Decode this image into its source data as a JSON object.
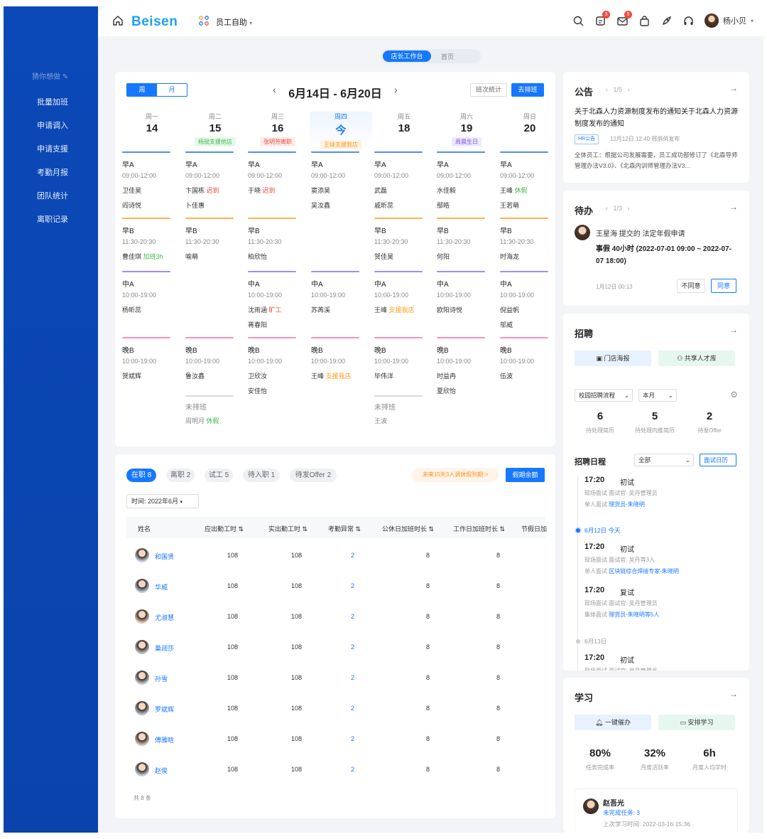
{
  "header": {
    "logo": "Beisen",
    "nav_label": "员工自助",
    "user_name": "杨小贝",
    "badges": [
      "3",
      "5"
    ]
  },
  "sidebar": {
    "guess": "猜你想做",
    "items": [
      "批量加班",
      "申请调入",
      "申请支援",
      "考勤月报",
      "团队统计",
      "离职记录"
    ]
  },
  "top_tabs": [
    "店长工作台",
    "首页"
  ],
  "schedule": {
    "view_week": "周",
    "view_month": "月",
    "date_range": "6月14日 - 6月20日",
    "btn_stats": "班次统计",
    "btn_go": "去排班",
    "days": [
      {
        "weekday": "周一",
        "num": "14",
        "tag": ""
      },
      {
        "weekday": "周二",
        "num": "15",
        "tag": "杨锐支援他店",
        "tag_color": "#3fb950",
        "tag_bg": "#e7f7ec"
      },
      {
        "weekday": "周三",
        "num": "16",
        "tag": "张明芳离职",
        "tag_color": "#f04b3b",
        "tag_bg": "#fdeceb"
      },
      {
        "weekday": "周四",
        "num": "今",
        "tag": "王峰支援我店",
        "tag_color": "#ff9c1a",
        "tag_bg": "#fff3e3"
      },
      {
        "weekday": "周五",
        "num": "18",
        "tag": ""
      },
      {
        "weekday": "周六",
        "num": "19",
        "tag": "周晨生日",
        "tag_color": "#7e57e8",
        "tag_bg": "#efe9ff"
      },
      {
        "weekday": "周日",
        "num": "20",
        "tag": ""
      }
    ],
    "shift_colors": {
      "早A": "#4d8dff",
      "早B": "#ffb24d",
      "中A": "#9e8cff",
      "晚B": "#ff8fc2"
    },
    "columns": [
      {
        "shifts": [
          {
            "name": "早A",
            "time": "09:00-12:00",
            "people": [
              [
                "卫佳昊",
                ""
              ],
              [
                "阎诗悦",
                ""
              ]
            ]
          },
          {
            "name": "早B",
            "time": "11:30-20:30",
            "people": [
              [
                "曹佳琪",
                "加班3h",
                "green"
              ]
            ]
          },
          {
            "name": "中A",
            "time": "10:00-19:00",
            "people": [
              [
                "杨昕蕊",
                ""
              ]
            ]
          },
          {
            "name": "晚B",
            "time": "10:00-19:00",
            "people": [
              [
                "贺斌辉",
                ""
              ]
            ]
          }
        ]
      },
      {
        "shifts": [
          {
            "name": "早A",
            "time": "09:00-12:00",
            "people": [
              [
                "卞国栋",
                "迟到",
                "red"
              ],
              [
                "卜佳惠",
                ""
              ]
            ]
          },
          {
            "name": "早B",
            "time": "11:30-20:30",
            "people": [
              [
                "喻萌",
                ""
              ]
            ]
          },
          {
            "name": "晚B",
            "time": "10:00-19:00",
            "people": [
              [
                "鲁汝鑫",
                ""
              ]
            ]
          },
          {
            "name": "未排班",
            "time": "",
            "people": [
              [
                "周明月",
                "休假",
                "green"
              ]
            ],
            "unscheduled": true
          }
        ]
      },
      {
        "shifts": [
          {
            "name": "早A",
            "time": "09:00-12:00",
            "people": [
              [
                "于晓",
                "迟到",
                "red"
              ]
            ]
          },
          {
            "name": "早B",
            "time": "11:30-20:30",
            "people": [
              [
                "柏欣怡",
                ""
              ]
            ]
          },
          {
            "name": "中A",
            "time": "10:00-19:00",
            "people": [
              [
                "沈雨涵",
                "旷工",
                "red"
              ],
              [
                "蒋春阳",
                ""
              ]
            ]
          },
          {
            "name": "晚B",
            "time": "10:00-19:00",
            "people": [
              [
                "卫欣汝",
                ""
              ],
              [
                "安佳怡",
                ""
              ]
            ]
          }
        ]
      },
      {
        "shifts": [
          {
            "name": "早A",
            "time": "09:00-12:00",
            "people": [
              [
                "窦添昊",
                ""
              ],
              [
                "吴汝鑫",
                ""
              ]
            ]
          },
          {
            "name": "中A",
            "time": "10:00-19:00",
            "people": [
              [
                "苏苒溪",
                ""
              ]
            ]
          },
          {
            "name": "晚B",
            "time": "10:00-19:00",
            "people": [
              [
                "王峰",
                "支援我店",
                "orange"
              ]
            ]
          }
        ]
      },
      {
        "shifts": [
          {
            "name": "早A",
            "time": "09:00-12:00",
            "people": [
              [
                "武磊",
                ""
              ],
              [
                "戚昕蕊",
                ""
              ]
            ]
          },
          {
            "name": "早B",
            "time": "11:30-20:30",
            "people": [
              [
                "贺佳昊",
                ""
              ]
            ]
          },
          {
            "name": "中A",
            "time": "10:00-19:00",
            "people": [
              [
                "王峰",
                "支援我店",
                "orange"
              ]
            ]
          },
          {
            "name": "晚B",
            "time": "10:00-19:00",
            "people": [
              [
                "毕伟洋",
                ""
              ]
            ]
          },
          {
            "name": "未排班",
            "time": "",
            "people": [
              [
                "王波",
                ""
              ]
            ],
            "unscheduled": true
          }
        ]
      },
      {
        "shifts": [
          {
            "name": "早A",
            "time": "09:00-12:00",
            "people": [
              [
                "水佳毅",
                ""
              ],
              [
                "鄢皓",
                ""
              ]
            ]
          },
          {
            "name": "早B",
            "time": "11:30-20:30",
            "people": [
              [
                "何阳",
                ""
              ]
            ]
          },
          {
            "name": "中A",
            "time": "10:00-19:00",
            "people": [
              [
                "欧阳诗悦",
                ""
              ]
            ]
          },
          {
            "name": "晚B",
            "time": "10:00-19:00",
            "people": [
              [
                "时益冉",
                ""
              ],
              [
                "夏欣怡",
                ""
              ]
            ]
          }
        ]
      },
      {
        "shifts": [
          {
            "name": "早A",
            "time": "09:00-12:00",
            "people": [
              [
                "王峰",
                "休假",
                "green"
              ],
              [
                "王若萌",
                ""
              ]
            ]
          },
          {
            "name": "早B",
            "time": "11:30-20:30",
            "people": [
              [
                "时海龙",
                ""
              ]
            ]
          },
          {
            "name": "中A",
            "time": "10:00-19:00",
            "people": [
              [
                "倪益帆",
                ""
              ],
              [
                "邬威",
                ""
              ]
            ]
          },
          {
            "name": "晚B",
            "time": "10:00-19:00",
            "people": [
              [
                "伍波",
                ""
              ]
            ]
          }
        ]
      }
    ]
  },
  "staff": {
    "pills": [
      "在职 8",
      "离职 2",
      "试工 5",
      "待入职 1",
      "待发Offer 2"
    ],
    "notice": "未来15天3人调休假到期 >",
    "btn_rest": "假期余额",
    "time_filter": "时间: 2022年6月",
    "headers": [
      "姓名",
      "应出勤工时",
      "实出勤工时",
      "考勤异常",
      "公休日加班时长",
      "工作日加班时长",
      "节假日加"
    ],
    "rows": [
      {
        "name": "和国贤",
        "due": "108",
        "actual": "108",
        "abn": "2",
        "rest_ot": "8",
        "work_ot": "8"
      },
      {
        "name": "华威",
        "due": "108",
        "actual": "108",
        "abn": "2",
        "rest_ot": "8",
        "work_ot": "8"
      },
      {
        "name": "尤淑慧",
        "due": "108",
        "actual": "108",
        "abn": "2",
        "rest_ot": "8",
        "work_ot": "8"
      },
      {
        "name": "巢润莎",
        "due": "108",
        "actual": "108",
        "abn": "2",
        "rest_ot": "8",
        "work_ot": "8"
      },
      {
        "name": "孙雪",
        "due": "108",
        "actual": "108",
        "abn": "2",
        "rest_ot": "8",
        "work_ot": "8"
      },
      {
        "name": "罗斌辉",
        "due": "108",
        "actual": "108",
        "abn": "2",
        "rest_ot": "8",
        "work_ot": "8"
      },
      {
        "name": "傅雅晗",
        "due": "108",
        "actual": "108",
        "abn": "2",
        "rest_ot": "8",
        "work_ot": "8"
      },
      {
        "name": "赵俊",
        "due": "108",
        "actual": "108",
        "abn": "2",
        "rest_ot": "8",
        "work_ot": "8"
      }
    ],
    "count": "共 8 条"
  },
  "announce": {
    "title": "公告",
    "pager": "1/5",
    "headline": "关于北森人力资源制度发布的通知关于北森人力资源制度发布的通知",
    "tag": "HR公告",
    "meta": "12月12日 12:40 邢俏俏发布",
    "body": "全体员工：根据公司发展需要，员工成功部修订了《北森导师管理办法V3.0》、《北森内训师管理办法V3..."
  },
  "todo": {
    "title": "待办",
    "pager": "1/3",
    "who": "王星海  提交的  法定年假申请",
    "body": "事假 40小时 (2022-07-01 09:00 ~ 2022-07-07 18:00)",
    "time": "1月12日 00:13",
    "reject": "不同意",
    "approve": "同意"
  },
  "recruit": {
    "title": "招聘",
    "btn_poster": "门店海报",
    "btn_talent": "共享人才库",
    "flow": "校园招聘流程",
    "month": "本月",
    "stats": [
      {
        "n": "6",
        "l": "待处理简历"
      },
      {
        "n": "5",
        "l": "待处理内推简历"
      },
      {
        "n": "2",
        "l": "待发Offer"
      }
    ],
    "sched_title": "招聘日程",
    "sched_filter": "全部",
    "btn_cal": "面试日历",
    "items": [
      {
        "time": "17:20",
        "kind": "初试",
        "meta1": "现场面试    面试官: 吴丹管理员",
        "meta2a": "单人面试",
        "meta2b": "理货员-朱晓明"
      },
      {
        "day": "6月12日 今天"
      },
      {
        "time": "17:20",
        "kind": "初试",
        "meta1": "现场面试    面试官: 吴丹等3人",
        "meta2a": "单人面试",
        "meta2b": "区块链综合焊接专家-朱晓明"
      },
      {
        "time": "17:20",
        "kind": "复试",
        "meta1": "现场面试    面试官: 吴丹管理员",
        "meta2a": "集体面试",
        "meta2b": "理货员-朱晓明等5人"
      },
      {
        "day": "6月13日"
      },
      {
        "time": "17:20",
        "kind": "初试",
        "meta1": "现场面试    面试官: 吴丹管理员"
      }
    ]
  },
  "learn": {
    "title": "学习",
    "btn_remind": "一键催办",
    "btn_arrange": "安排学习",
    "stats": [
      {
        "n": "80%",
        "l": "任务完成率"
      },
      {
        "n": "32%",
        "l": "月度活跃率"
      },
      {
        "n": "6h",
        "l": "月度人均学时"
      }
    ],
    "person": "赵吾光",
    "task": "未完成任务: 3",
    "last": "上次学习时间: 2022-03-16 15:36"
  }
}
